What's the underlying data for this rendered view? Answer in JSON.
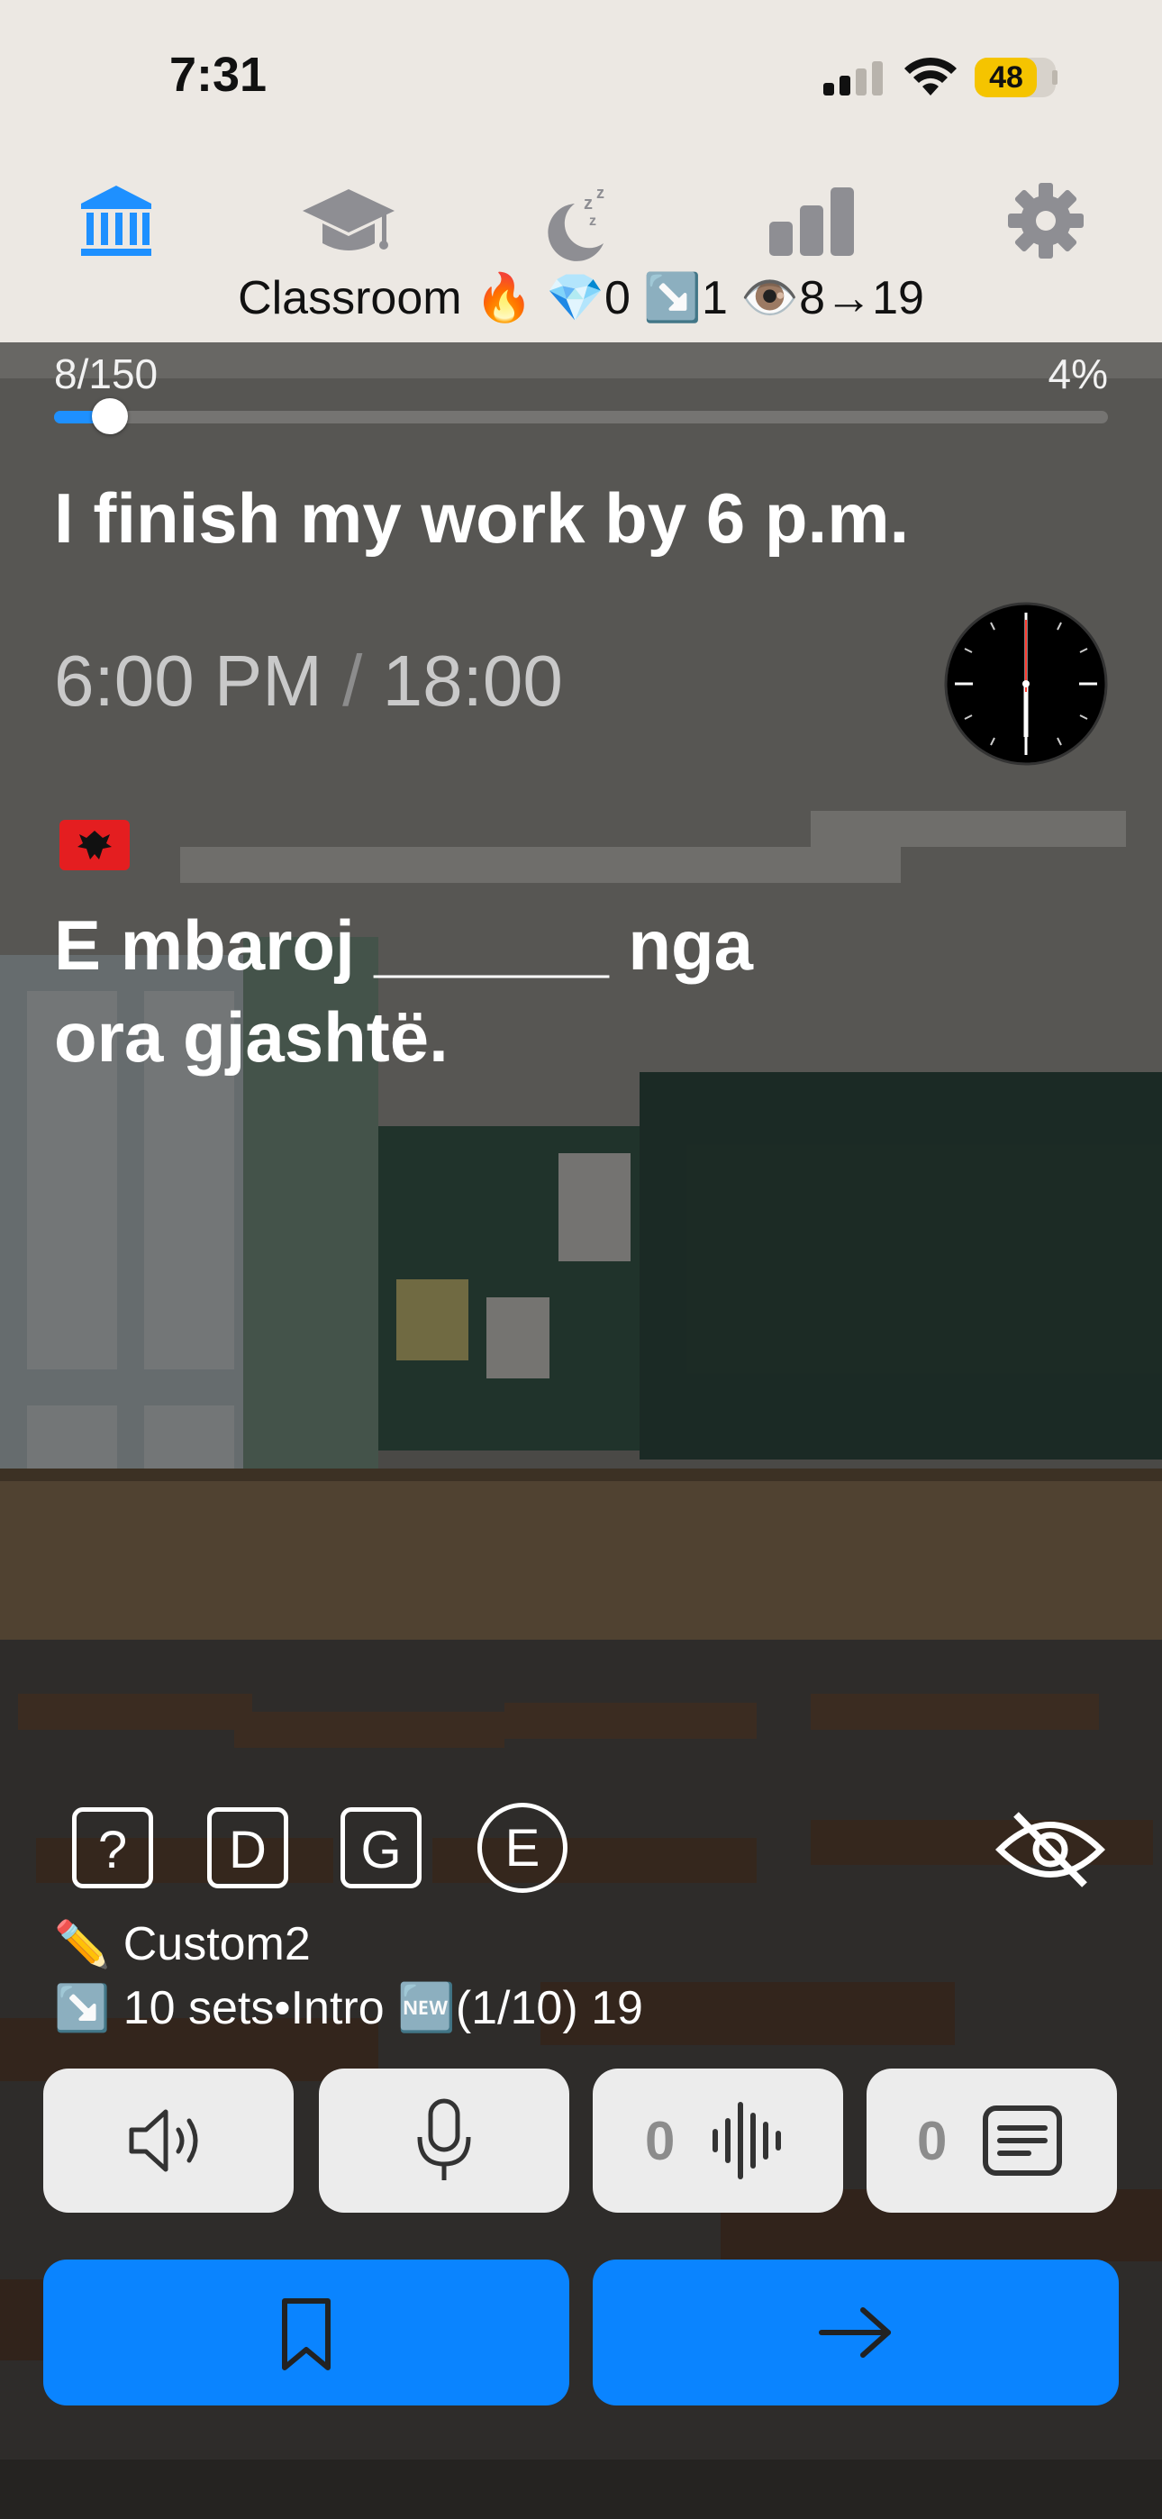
{
  "status_bar": {
    "time": "7:31",
    "battery": "48",
    "battery_level": 0.48
  },
  "nav": {
    "label": "Classroom 🔥 💎0 ↘️1 👁️8→19",
    "tabs": [
      {
        "icon": "museum-icon",
        "active": true
      },
      {
        "icon": "graduation-cap-icon",
        "active": false
      },
      {
        "icon": "sleep-moon-icon",
        "active": false
      },
      {
        "icon": "bar-chart-icon",
        "active": false
      },
      {
        "icon": "gear-icon",
        "active": false
      }
    ],
    "accent": "#1e90ff"
  },
  "progress": {
    "count": "8/150",
    "percent": "4%",
    "fraction": 0.0533
  },
  "card": {
    "sentence_en": "I finish my work by 6 p.m.",
    "time_12": "6:00 PM",
    "time_sep": "/",
    "time_24": "18:00",
    "flag_icon": "albania-flag-icon",
    "sentence_sq_line1": "E mbaroj ______ nga",
    "sentence_sq_line2": "ora gjashtë."
  },
  "tools": {
    "help": "?",
    "d": "D",
    "g": "G",
    "e": "E"
  },
  "deck": {
    "name_emoji": "✏️",
    "name": "Custom2",
    "info_emoji": "↘️",
    "info": "10 sets•Intro 🆕(1/10) 19"
  },
  "audio": {
    "waveform_count": "0",
    "transcript_count": "0"
  },
  "colors": {
    "primary_button": "#0a84ff",
    "audio_button_bg": "#ececec"
  }
}
